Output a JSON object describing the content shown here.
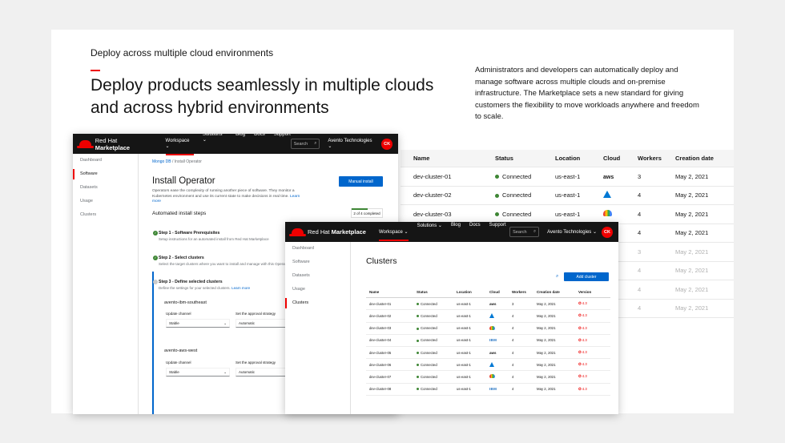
{
  "section": {
    "eyebrow": "Deploy across multiple cloud environments",
    "headline": "Deploy products seamlessly in multiple clouds and across hybrid environments",
    "description": "Administrators and developers can automatically deploy and manage software across multiple clouds and on-premise infrastructure. The Marketplace sets a new standard for giving customers the flexibility to move workloads anywhere and freedom to scale."
  },
  "marketplace": {
    "brand_regular": "Red Hat ",
    "brand_bold": "Marketplace",
    "nav": [
      "Workspace ⌄",
      "Solutions ⌄",
      "Blog",
      "Docs",
      "Support"
    ],
    "search_placeholder": "Search",
    "org": "Avento Technologies ⌄",
    "avatar": "CK",
    "sidebar": [
      "Dashboard",
      "Software",
      "Datasets",
      "Usage",
      "Clusters"
    ]
  },
  "install_operator": {
    "breadcrumb": [
      "Mongo DB",
      "/  Install Operator"
    ],
    "title": "Install Operator",
    "subtitle": "Operators ease the complexity of running another piece of software. They monitor a Kubernetes environment and use its current state to make decisions in real time.",
    "learn_more": "Learn more",
    "manual_install": "Manual install",
    "steps_heading": "Automated install steps",
    "progress": "2 of 4 completed",
    "progress_fraction": 0.5,
    "steps": [
      {
        "title": "Step 1 - Software Prerequisites",
        "desc": "Setup instructions for an automated install from Red Hat Marketplace",
        "done": true
      },
      {
        "title": "Step 2 - Select clusters",
        "desc": "Select the target clusters where you want to install and manage with this Operator",
        "done": true
      },
      {
        "title": "Step 3 - Define selected clusters",
        "desc": "Define the settings for your selected clusters.",
        "link": "Learn more",
        "done": false
      }
    ],
    "clusters": [
      {
        "name": "avento-ibm-southeast",
        "channel_label": "Update channel",
        "channel": "Stable",
        "strategy_label": "Set the approval strategy",
        "strategy": "Automatic"
      },
      {
        "name": "avento-aws-west",
        "channel_label": "Update channel",
        "channel": "Stable",
        "strategy_label": "Set the approval strategy",
        "strategy": "Automatic"
      }
    ]
  },
  "clusters_page": {
    "title": "Clusters",
    "add_button": "Add cluster",
    "columns": [
      "Name",
      "Status",
      "Location",
      "Cloud",
      "Workers",
      "Creation date",
      "Version"
    ],
    "rows": [
      {
        "name": "dev-cluster-01",
        "status": "Connected",
        "location": "us-east-1",
        "cloud": "aws",
        "workers": "3",
        "date": "May 2, 2021",
        "version": "4.3"
      },
      {
        "name": "dev-cluster-02",
        "status": "Connected",
        "location": "us-east-1",
        "cloud": "azure",
        "workers": "4",
        "date": "May 2, 2021",
        "version": "4.3"
      },
      {
        "name": "dev-cluster-03",
        "status": "Connected",
        "location": "us-east-1",
        "cloud": "gcp",
        "workers": "4",
        "date": "May 2, 2021",
        "version": "4.3"
      },
      {
        "name": "dev-cluster-04",
        "status": "Connected",
        "location": "us-east-1",
        "cloud": "ibm",
        "workers": "4",
        "date": "May 2, 2021",
        "version": "4.3"
      },
      {
        "name": "dev-cluster-05",
        "status": "Connected",
        "location": "us-east-1",
        "cloud": "aws",
        "workers": "4",
        "date": "May 2, 2021",
        "version": "4.3"
      },
      {
        "name": "dev-cluster-06",
        "status": "Connected",
        "location": "us-east-1",
        "cloud": "azure",
        "workers": "4",
        "date": "May 2, 2021",
        "version": "4.3"
      },
      {
        "name": "dev-cluster-07",
        "status": "Connected",
        "location": "us-east-1",
        "cloud": "gcp",
        "workers": "4",
        "date": "May 2, 2021",
        "version": "4.3"
      },
      {
        "name": "dev-cluster-08",
        "status": "Connected",
        "location": "us-east-1",
        "cloud": "ibm",
        "workers": "4",
        "date": "May 2, 2021",
        "version": "4.3"
      }
    ]
  },
  "back_table": {
    "columns": [
      "Name",
      "Status",
      "Location",
      "Cloud",
      "Workers",
      "Creation date"
    ],
    "rows": [
      {
        "name": "dev-cluster-01",
        "status": "Connected",
        "location": "us-east-1",
        "cloud": "aws",
        "workers": "3",
        "date": "May 2, 2021"
      },
      {
        "name": "dev-cluster-02",
        "status": "Connected",
        "location": "us-east-1",
        "cloud": "azure",
        "workers": "4",
        "date": "May 2, 2021"
      },
      {
        "name": "dev-cluster-03",
        "status": "Connected",
        "location": "us-east-1",
        "cloud": "gcp",
        "workers": "4",
        "date": "May 2, 2021"
      },
      {
        "workers": "4",
        "date": "May 2, 2021"
      },
      {
        "workers": "3",
        "date": "May 2, 2021"
      },
      {
        "workers": "4",
        "date": "May 2, 2021"
      },
      {
        "workers": "4",
        "date": "May 2, 2021"
      },
      {
        "workers": "4",
        "date": "May 2, 2021"
      }
    ]
  },
  "colors": {
    "accent": "#ee0000",
    "link": "#0066cc",
    "success": "#3e8635",
    "header_bg": "#151515"
  }
}
